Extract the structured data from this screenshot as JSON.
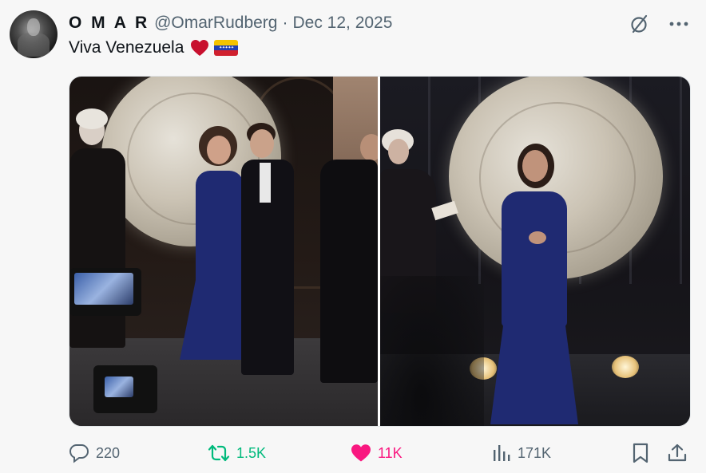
{
  "author": {
    "display_name": "O M A R",
    "handle": "@OmarRudberg",
    "separator": "·",
    "date": "Dec 12, 2025"
  },
  "tweet": {
    "text": "Viva Venezuela",
    "emojis": [
      "red-heart",
      "venezuela-flag"
    ]
  },
  "top_icons": [
    "grok-icon",
    "more-icon"
  ],
  "media": {
    "count": 2
  },
  "actions": {
    "replies": "220",
    "reposts": "1.5K",
    "likes": "11K",
    "views": "171K"
  },
  "colors": {
    "background": "#f7f7f7",
    "text_primary": "#0f1419",
    "text_secondary": "#536471",
    "repost_active": "#00ba7c",
    "like_active": "#f91880",
    "dress_blue": "#1f2a72"
  }
}
